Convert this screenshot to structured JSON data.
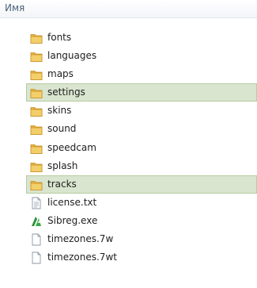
{
  "header": {
    "column_name": "Имя"
  },
  "items": [
    {
      "name": "fonts",
      "kind": "folder",
      "selected": false
    },
    {
      "name": "languages",
      "kind": "folder",
      "selected": false
    },
    {
      "name": "maps",
      "kind": "folder",
      "selected": false
    },
    {
      "name": "settings",
      "kind": "folder",
      "selected": true
    },
    {
      "name": "skins",
      "kind": "folder",
      "selected": false
    },
    {
      "name": "sound",
      "kind": "folder",
      "selected": false
    },
    {
      "name": "speedcam",
      "kind": "folder",
      "selected": false
    },
    {
      "name": "splash",
      "kind": "folder",
      "selected": false
    },
    {
      "name": "tracks",
      "kind": "folder",
      "selected": true
    },
    {
      "name": "license.txt",
      "kind": "text-file",
      "selected": false
    },
    {
      "name": "Sibreg.exe",
      "kind": "exe-file",
      "selected": false
    },
    {
      "name": "timezones.7w",
      "kind": "blank-file",
      "selected": false
    },
    {
      "name": "timezones.7wt",
      "kind": "blank-file",
      "selected": false
    }
  ]
}
